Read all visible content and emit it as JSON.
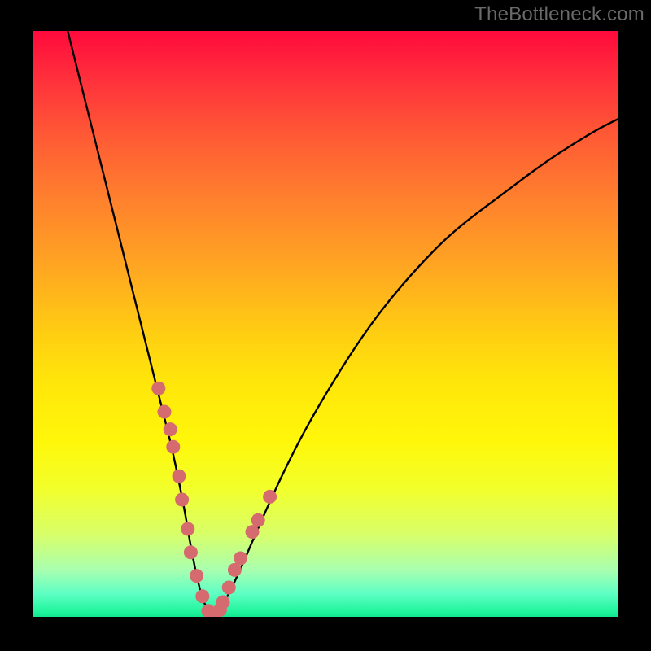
{
  "watermark": "TheBottleneck.com",
  "background": {
    "frame_color": "#000000",
    "gradient_top": "#ff0a3c",
    "gradient_bottom": "#11e88f"
  },
  "chart_data": {
    "type": "line",
    "title": "",
    "xlabel": "",
    "ylabel": "",
    "xlim": [
      0,
      100
    ],
    "ylim": [
      0,
      100
    ],
    "grid": false,
    "legend": false,
    "series": [
      {
        "name": "curve",
        "x": [
          6,
          8,
          10,
          12,
          14,
          16,
          18,
          20,
          22,
          24,
          26,
          27,
          28,
          29,
          30,
          31,
          32,
          33,
          35,
          38,
          42,
          46,
          50,
          55,
          60,
          66,
          72,
          80,
          88,
          96,
          100
        ],
        "y": [
          100,
          92,
          84,
          76,
          68,
          60,
          52,
          44,
          36,
          28,
          18,
          12,
          7,
          3,
          1,
          0.5,
          1,
          3,
          7,
          14,
          23,
          31,
          38,
          46,
          53,
          60,
          66,
          72,
          78,
          83,
          85
        ],
        "note": "V-shaped curve; minimum (optimum / no bottleneck) at x≈31, y≈0"
      },
      {
        "name": "highlighted-points",
        "x": [
          21.5,
          22.5,
          23.5,
          24.0,
          25.0,
          25.5,
          26.5,
          27.0,
          28.0,
          29.0,
          30.0,
          30.5,
          31.0,
          32.0,
          32.5,
          33.5,
          34.5,
          35.5,
          37.5,
          38.5,
          40.5
        ],
        "y": [
          39.0,
          35.0,
          32.0,
          29.0,
          24.0,
          20.0,
          15.0,
          11.0,
          7.0,
          3.5,
          1.0,
          0.6,
          0.5,
          1.2,
          2.5,
          5.0,
          8.0,
          10.0,
          14.5,
          16.5,
          20.5
        ],
        "note": "Pink dot markers clustered around the minimum on the left branch and partway up the right branch"
      }
    ]
  }
}
